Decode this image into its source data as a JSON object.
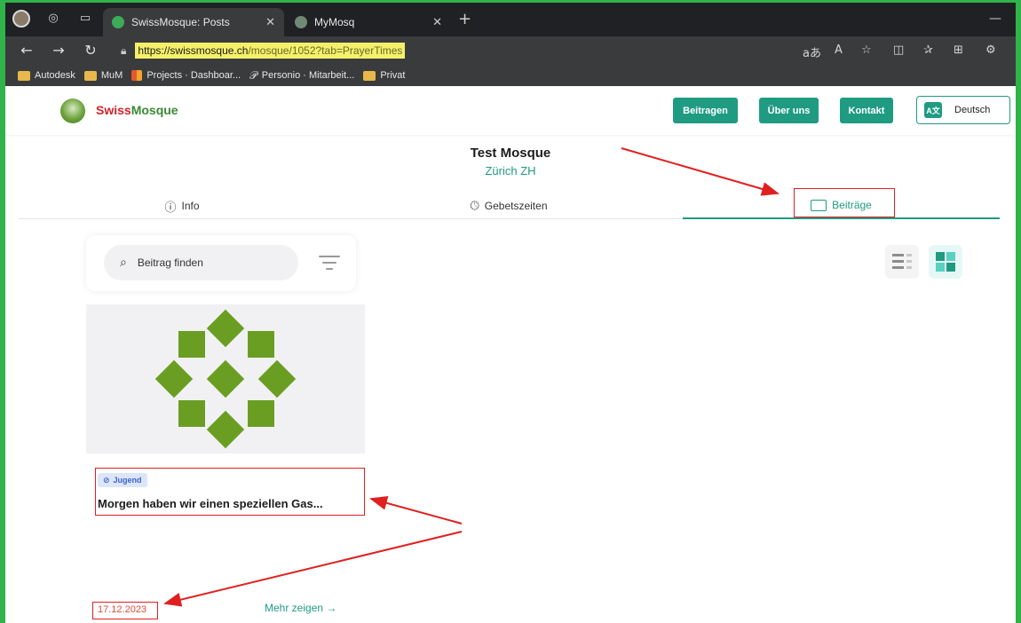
{
  "browser": {
    "tabs": [
      {
        "label": "SwissMosque: Posts",
        "active": true
      },
      {
        "label": "MyMosq",
        "active": false
      }
    ],
    "url_host": "https://swissmosque.ch",
    "url_rest": "/mosque/1052?tab=PrayerTimes",
    "bookmarks": [
      "Autodesk",
      "MuM",
      "Projects · Dashboar...",
      "Personio · Mitarbeit...",
      "Privat"
    ]
  },
  "site": {
    "logo_swiss": "Swiss",
    "logo_mosque": "Mosque",
    "nav": {
      "beitragen": "Beitragen",
      "ueber_uns": "Über uns",
      "kontakt": "Kontakt",
      "language": "Deutsch"
    }
  },
  "mosque": {
    "name": "Test Mosque",
    "city": "Zürich ZH"
  },
  "page_tabs": [
    {
      "label": "Info",
      "icon": "info-icon"
    },
    {
      "label": "Gebetszeiten",
      "icon": "clock-icon"
    },
    {
      "label": "Beiträge",
      "icon": "news-icon",
      "active": true
    }
  ],
  "search": {
    "placeholder": "Beitrag finden"
  },
  "post": {
    "tag": "Jugend",
    "title": "Morgen haben wir einen speziellen Gas...",
    "date": "17.12.2023",
    "more": "Mehr zeigen →"
  },
  "colors": {
    "accent": "#1f9b82",
    "logo_green": "#6a9e22",
    "annotation_red": "#e02020",
    "url_highlight": "#f5f06a"
  }
}
